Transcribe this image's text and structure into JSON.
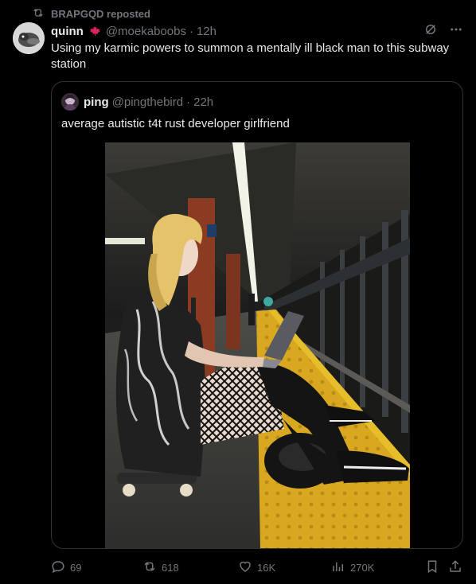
{
  "repost": {
    "label": "BRAPGQD reposted"
  },
  "tweet": {
    "author_name": "quinn",
    "handle": "@moekaboobs",
    "separator": "·",
    "time": "12h",
    "text": "Using my karmic powers to summon a mentally ill black man to this subway station"
  },
  "quote": {
    "author_name": "ping",
    "handle": "@pingthebird",
    "separator": "·",
    "time": "22h",
    "text": "average autistic t4t rust developer girlfriend"
  },
  "actions": {
    "replies": "69",
    "reposts": "618",
    "likes": "16K",
    "views": "270K"
  },
  "colors": {
    "background": "#000000",
    "text": "#e7e9ea",
    "muted": "#71767b",
    "border": "#2f3336",
    "maple_leaf": "#e0245e"
  },
  "icons": [
    "repost-icon",
    "maple-leaf-icon",
    "grok-icon",
    "more-icon",
    "reply-icon",
    "like-icon",
    "views-icon",
    "bookmark-icon",
    "share-icon"
  ]
}
